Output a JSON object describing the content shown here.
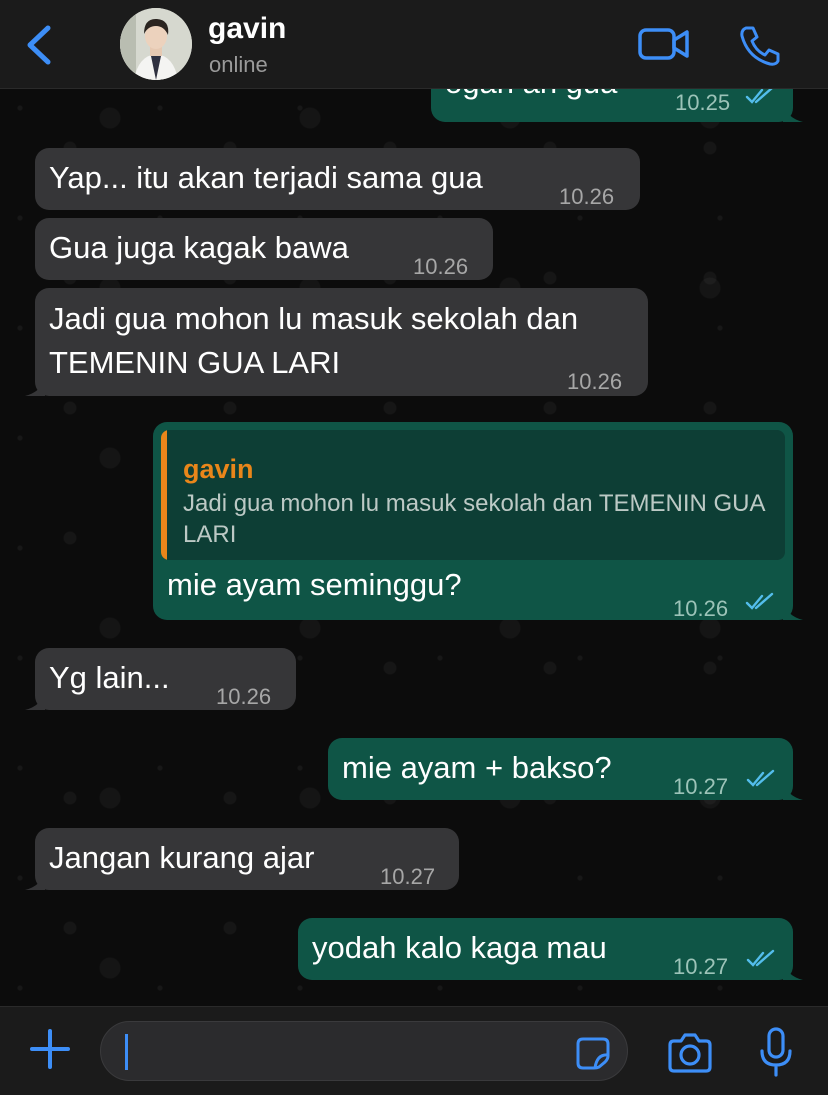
{
  "header": {
    "contact_name": "gavin",
    "status": "online"
  },
  "messages": [
    {
      "side": "out",
      "text": "ogah ah gua",
      "time": "10.25",
      "read": true
    },
    {
      "side": "in",
      "text": "Yap... itu akan terjadi sama gua",
      "time": "10.26"
    },
    {
      "side": "in",
      "text": "Gua juga kagak bawa",
      "time": "10.26"
    },
    {
      "side": "in",
      "text_line1": "Jadi gua mohon lu masuk sekolah dan",
      "text_line2": "TEMENIN GUA LARI",
      "time": "10.26"
    },
    {
      "side": "out",
      "quote_name": "gavin",
      "quote_text": "Jadi gua mohon lu masuk sekolah dan TEMENIN GUA LARI",
      "text": "mie ayam seminggu?",
      "time": "10.26",
      "read": true
    },
    {
      "side": "in",
      "text": "Yg lain...",
      "time": "10.26"
    },
    {
      "side": "out",
      "text": "mie ayam + bakso?",
      "time": "10.27",
      "read": true
    },
    {
      "side": "in",
      "text": "Jangan kurang ajar",
      "time": "10.27"
    },
    {
      "side": "out",
      "text": "yodah kalo kaga mau",
      "time": "10.27",
      "read": true
    }
  ],
  "composer": {
    "value": ""
  },
  "colors": {
    "accent": "#3d8ef7",
    "incoming_bubble": "#363638",
    "outgoing_bubble": "#0f5546",
    "quote_name": "#e9861a",
    "read_ticks": "#53bdeb"
  },
  "icons": [
    "back-chevron-icon",
    "video-call-icon",
    "phone-icon",
    "plus-icon",
    "sticker-icon",
    "camera-icon",
    "microphone-icon",
    "read-ticks-icon"
  ]
}
